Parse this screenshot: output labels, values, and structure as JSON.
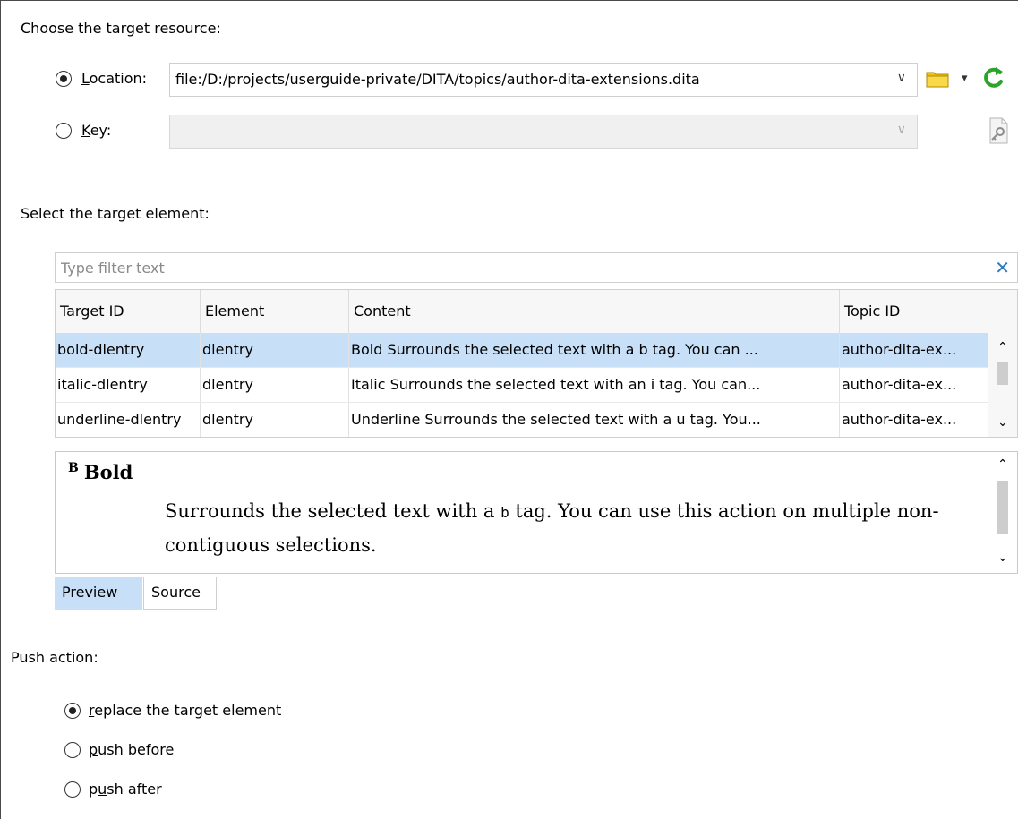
{
  "target_resource": {
    "heading": "Choose the target resource:",
    "location": {
      "label": "Location:",
      "mnemonic": "L",
      "label_rest": "ocation:",
      "selected": true,
      "value": "file:/D:/projects/userguide-private/DITA/topics/author-dita-extensions.dita"
    },
    "key": {
      "label": "Key:",
      "mnemonic": "K",
      "label_rest": "ey:",
      "selected": false,
      "value": ""
    },
    "icons": [
      "folder-icon",
      "dropdown-caret-icon",
      "refresh-icon",
      "key-reference-icon"
    ]
  },
  "target_element": {
    "heading": "Select the target element:",
    "filter": {
      "placeholder": "Type filter text",
      "value": ""
    },
    "table": {
      "columns": [
        "Target ID",
        "Element",
        "Content",
        "Topic ID"
      ],
      "rows": [
        {
          "target_id": "bold-dlentry",
          "element": "dlentry",
          "content": "Bold Surrounds the selected text with a b tag. You can ...",
          "topic_id": "author-dita-ex...",
          "selected": true
        },
        {
          "target_id": "italic-dlentry",
          "element": "dlentry",
          "content": "Italic Surrounds the selected text with an i tag. You can...",
          "topic_id": "author-dita-ex...",
          "selected": false
        },
        {
          "target_id": "underline-dlentry",
          "element": "dlentry",
          "content": "Underline Surrounds the selected text with a u tag. You...",
          "topic_id": "author-dita-ex...",
          "selected": false
        }
      ]
    },
    "preview": {
      "icon_letter": "B",
      "title": "Bold",
      "body_before": "Surrounds the selected text with a ",
      "body_code": "b",
      "body_after": " tag. You can use this action on multiple non-contiguous selections."
    },
    "tabs": [
      {
        "label": "Preview",
        "active": true
      },
      {
        "label": "Source",
        "active": false
      }
    ]
  },
  "push_action": {
    "heading": "Push action:",
    "options": [
      {
        "label": "replace the target element",
        "mnemonic": "r",
        "rest": "eplace the target element",
        "selected": true
      },
      {
        "label": "push before",
        "mnemonic": "p",
        "rest": "ush before",
        "selected": false
      },
      {
        "label": "push after",
        "prefix": "p",
        "mnemonic": "u",
        "rest": "sh after",
        "selected": false
      }
    ]
  },
  "colors": {
    "selection": "#c7dff7",
    "refresh_green": "#2aa52a",
    "folder_yellow": "#f2c200",
    "clear_blue": "#2f78c0"
  }
}
